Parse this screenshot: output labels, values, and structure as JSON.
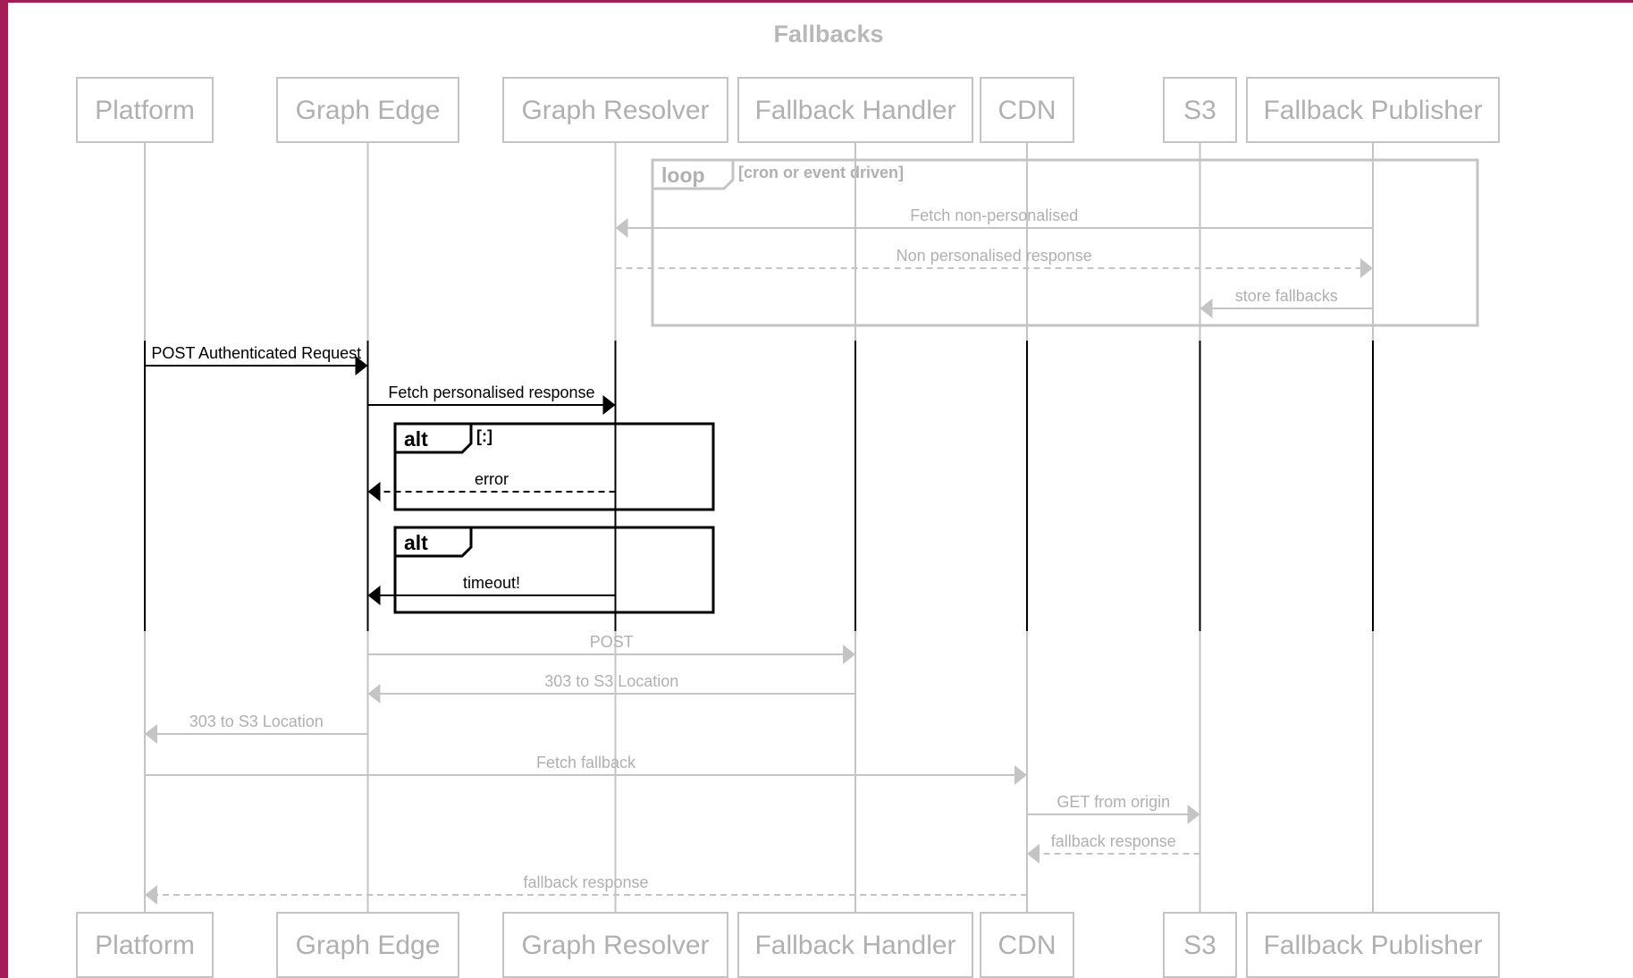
{
  "title": "Fallbacks",
  "colors": {
    "frame": "#a51d56",
    "dim": "#c4c4c4",
    "dim_text": "#b0b0b0",
    "active": "#000000",
    "background": "#ffffff"
  },
  "participants": [
    {
      "id": "platform",
      "label": "Platform"
    },
    {
      "id": "graph_edge",
      "label": "Graph Edge"
    },
    {
      "id": "graph_resolver",
      "label": "Graph Resolver"
    },
    {
      "id": "fallback_handler",
      "label": "Fallback Handler"
    },
    {
      "id": "cdn",
      "label": "CDN"
    },
    {
      "id": "s3",
      "label": "S3"
    },
    {
      "id": "fallback_publisher",
      "label": "Fallback Publisher"
    }
  ],
  "fragments": [
    {
      "kind": "loop",
      "label": "loop",
      "condition": "[cron or event driven]",
      "active": false
    },
    {
      "kind": "alt",
      "label": "alt",
      "condition": "[:]",
      "active": true
    },
    {
      "kind": "alt",
      "label": "alt",
      "condition": "",
      "active": true
    }
  ],
  "messages": [
    {
      "from": "fallback_publisher",
      "to": "graph_resolver",
      "label": "Fetch non-personalised",
      "style": "solid",
      "active": false
    },
    {
      "from": "graph_resolver",
      "to": "fallback_publisher",
      "label": "Non personalised response",
      "style": "dashed",
      "active": false
    },
    {
      "from": "fallback_publisher",
      "to": "s3",
      "label": "store fallbacks",
      "style": "solid",
      "active": false
    },
    {
      "from": "platform",
      "to": "graph_edge",
      "label": "POST Authenticated Request",
      "style": "solid",
      "active": true
    },
    {
      "from": "graph_edge",
      "to": "graph_resolver",
      "label": "Fetch personalised response",
      "style": "solid",
      "active": true
    },
    {
      "from": "graph_resolver",
      "to": "graph_edge",
      "label": "error",
      "style": "dashed",
      "active": true
    },
    {
      "from": "graph_resolver",
      "to": "graph_edge",
      "label": "timeout!",
      "style": "solid",
      "active": true
    },
    {
      "from": "graph_edge",
      "to": "fallback_handler",
      "label": "POST",
      "style": "solid",
      "active": false
    },
    {
      "from": "fallback_handler",
      "to": "graph_edge",
      "label": "303 to S3 Location",
      "style": "solid",
      "active": false
    },
    {
      "from": "graph_edge",
      "to": "platform",
      "label": "303 to S3 Location",
      "style": "solid",
      "active": false
    },
    {
      "from": "platform",
      "to": "cdn",
      "label": "Fetch fallback",
      "style": "solid",
      "active": false
    },
    {
      "from": "cdn",
      "to": "s3",
      "label": "GET from origin",
      "style": "solid",
      "active": false
    },
    {
      "from": "s3",
      "to": "cdn",
      "label": "fallback response",
      "style": "dashed",
      "active": false
    },
    {
      "from": "cdn",
      "to": "platform",
      "label": "fallback response",
      "style": "dashed",
      "active": false
    }
  ]
}
